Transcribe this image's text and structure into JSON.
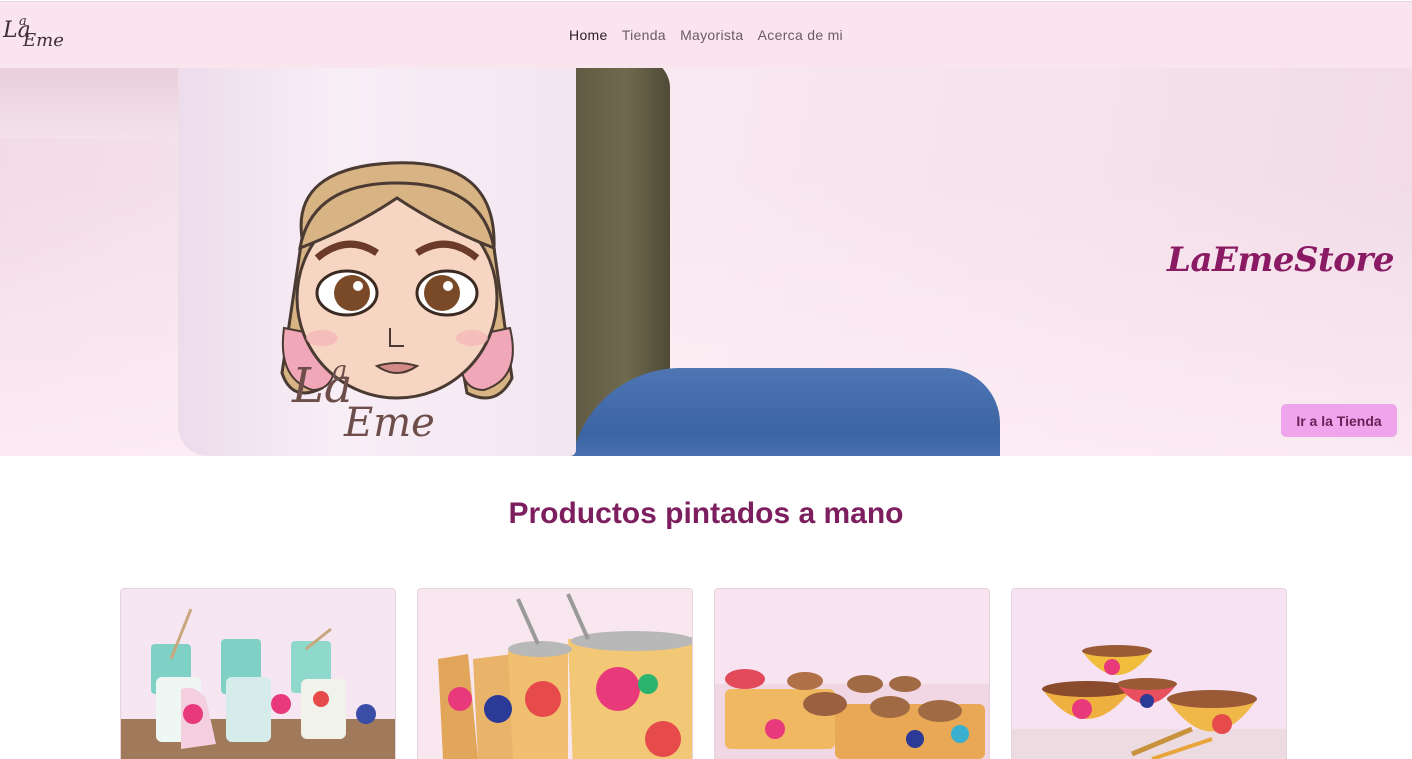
{
  "logo": {
    "line1": "La",
    "line2": "a",
    "line3": "Eme"
  },
  "nav": {
    "items": [
      {
        "label": "Home"
      },
      {
        "label": "Tienda"
      },
      {
        "label": "Mayorista"
      },
      {
        "label": "Acerca de mi"
      }
    ]
  },
  "hero": {
    "title": "LaEmeStore",
    "button_label": "Ir a la Tienda",
    "bag_signature": {
      "a": "La",
      "b": "a",
      "c": "Eme"
    }
  },
  "section": {
    "title": "Productos pintados a mano"
  },
  "products": [
    {
      "kind": "mates-con-bombilla"
    },
    {
      "kind": "mates-floreados"
    },
    {
      "kind": "bandejas-y-cuencos"
    },
    {
      "kind": "bowls-de-madera"
    }
  ],
  "colors": {
    "nav_bg": "#fae4ee",
    "accent": "#8a1a63",
    "button_bg": "#eea5ec",
    "section_title": "#7d1e5f"
  }
}
